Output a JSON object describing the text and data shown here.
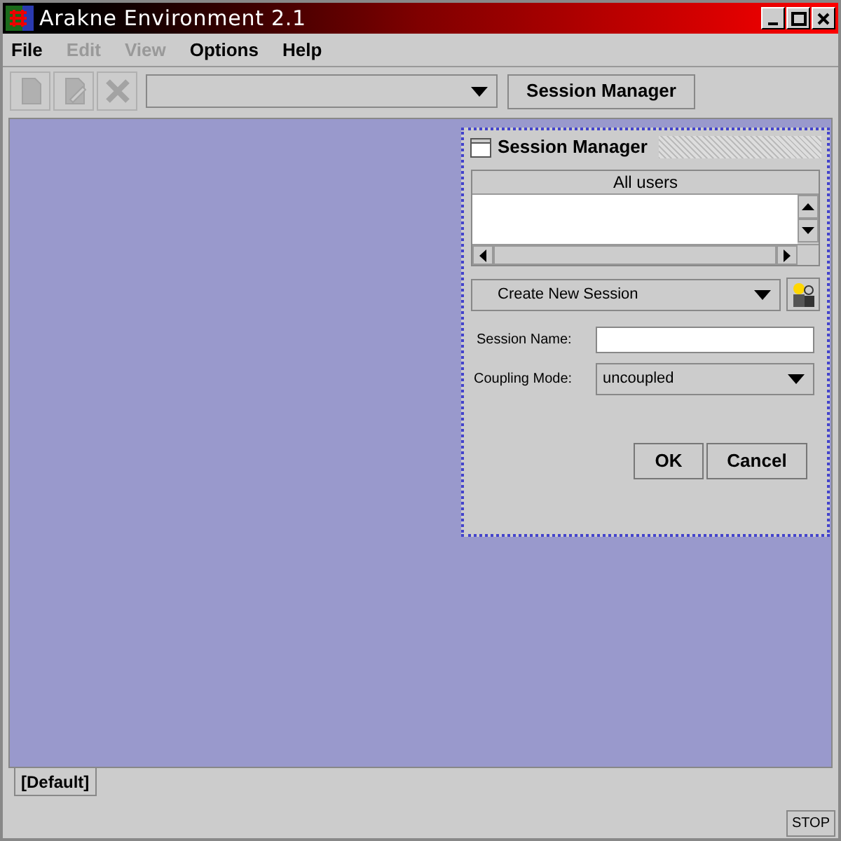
{
  "window": {
    "title": "Arakne Environment 2.1"
  },
  "menu": [
    {
      "label": "File",
      "disabled": false
    },
    {
      "label": "Edit",
      "disabled": true
    },
    {
      "label": "View",
      "disabled": true
    },
    {
      "label": "Options",
      "disabled": false
    },
    {
      "label": "Help",
      "disabled": false
    }
  ],
  "toolbar": {
    "buttons": [
      {
        "kind": "new",
        "disabled": true
      },
      {
        "kind": "edit",
        "disabled": true
      },
      {
        "kind": "delete",
        "disabled": true
      }
    ],
    "session_manager_button": "Session Manager"
  },
  "session_manager": {
    "title": "Session Manager",
    "users_header": "All users",
    "session_combo": "Create New Session",
    "session_name_label": "Session Name:",
    "coupling_label": "Coupling Mode:",
    "coupling_value": "uncoupled",
    "buttons": [
      "OK",
      "Cancel"
    ]
  },
  "tabs": [
    {
      "label": "[Default]",
      "selected": true
    }
  ],
  "stop_button": "STOP"
}
